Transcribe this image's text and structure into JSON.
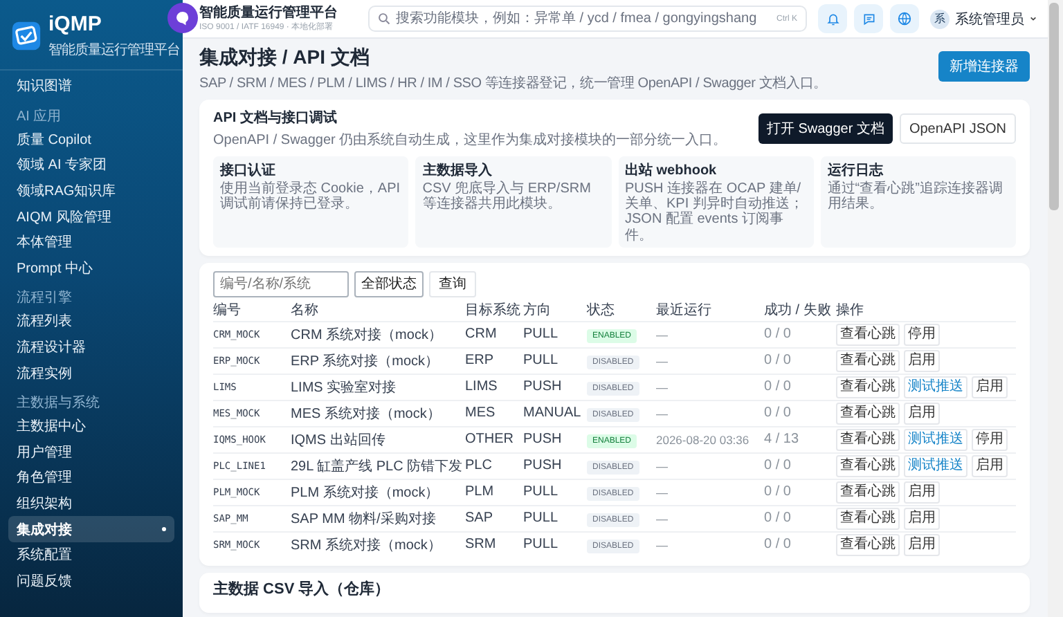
{
  "brand": {
    "name": "iQMP",
    "subtitle": "智能质量运行管理平台"
  },
  "sidebar": {
    "sections": [
      {
        "items": [
          {
            "label": "知识图谱",
            "selected": false
          }
        ]
      },
      {
        "heading": "AI 应用",
        "items": [
          {
            "label": "质量 Copilot",
            "selected": false
          },
          {
            "label": "领域 AI 专家团",
            "selected": false
          },
          {
            "label": "领域RAG知识库",
            "selected": false
          },
          {
            "label": "AIQM 风险管理",
            "selected": false
          },
          {
            "label": "本体管理",
            "selected": false
          },
          {
            "label": "Prompt 中心",
            "selected": false
          }
        ]
      },
      {
        "heading": "流程引擎",
        "items": [
          {
            "label": "流程列表",
            "selected": false
          },
          {
            "label": "流程设计器",
            "selected": false
          },
          {
            "label": "流程实例",
            "selected": false
          }
        ]
      },
      {
        "heading": "主数据与系统",
        "items": [
          {
            "label": "主数据中心",
            "selected": false
          },
          {
            "label": "用户管理",
            "selected": false
          },
          {
            "label": "角色管理",
            "selected": false
          },
          {
            "label": "组织架构",
            "selected": false
          },
          {
            "label": "集成对接",
            "selected": true
          },
          {
            "label": "系统配置",
            "selected": false
          },
          {
            "label": "问题反馈",
            "selected": false
          }
        ]
      }
    ]
  },
  "topbar": {
    "title": "智能质量运行管理平台",
    "subtitle": "ISO 9001 / IATF 16949 · 本地化部署",
    "search": {
      "placeholder": "搜索功能模块，例如：异常单 / ycd / fmea / gongyingshang",
      "shortcut": "Ctrl K"
    },
    "user": {
      "avatar": "系",
      "name": "系统管理员"
    }
  },
  "page": {
    "title": "集成对接 / API 文档",
    "subtitle": "SAP / SRM / MES / PLM / LIMS / HR / IM / SSO 等连接器登记，统一管理 OpenAPI / Swagger 文档入口。",
    "primary_button": "新增连接器"
  },
  "api_card": {
    "title": "API 文档与接口调试",
    "subtitle": "OpenAPI / Swagger 仍由系统自动生成，这里作为集成对接模块的一部分统一入口。",
    "buttons": [
      {
        "label": "打开 Swagger 文档",
        "kind": "dark"
      },
      {
        "label": "OpenAPI JSON",
        "kind": "outline"
      }
    ],
    "tiles": [
      {
        "title": "接口认证",
        "text": "使用当前登录态 Cookie，API 调试前请保持已登录。"
      },
      {
        "title": "主数据导入",
        "text": "CSV 兜底导入与 ERP/SRM 等连接器共用此模块。"
      },
      {
        "title": "出站 webhook",
        "text": "PUSH 连接器在 OCAP 建单/关单、KPI 判异时自动推送；JSON 配置 events 订阅事件。"
      },
      {
        "title": "运行日志",
        "text": "通过“查看心跳”追踪连接器调用结果。"
      }
    ]
  },
  "filters": {
    "search": {
      "placeholder": "编号/名称/系统"
    },
    "status_select": "全部状态",
    "query_button": "查询"
  },
  "table": {
    "columns": [
      "编号",
      "名称",
      "目标系统",
      "方向",
      "状态",
      "最近运行",
      "成功 / 失败",
      "操作"
    ],
    "rows": [
      {
        "code": "CRM_MOCK",
        "name": "CRM 系统对接（mock）",
        "system": "CRM",
        "direction": "PULL",
        "status": "ENABLED",
        "enabled": true,
        "last_run": "—",
        "ratio": "0 / 0",
        "actions": [
          {
            "label": "查看心跳",
            "kind": "plain"
          },
          {
            "label": "停用",
            "kind": "plain"
          }
        ]
      },
      {
        "code": "ERP_MOCK",
        "name": "ERP 系统对接（mock）",
        "system": "ERP",
        "direction": "PULL",
        "status": "DISABLED",
        "enabled": false,
        "last_run": "—",
        "ratio": "0 / 0",
        "actions": [
          {
            "label": "查看心跳",
            "kind": "plain"
          },
          {
            "label": "启用",
            "kind": "plain"
          }
        ]
      },
      {
        "code": "LIMS",
        "name": "LIMS 实验室对接",
        "system": "LIMS",
        "direction": "PUSH",
        "status": "DISABLED",
        "enabled": false,
        "last_run": "—",
        "ratio": "0 / 0",
        "actions": [
          {
            "label": "查看心跳",
            "kind": "plain"
          },
          {
            "label": "测试推送",
            "kind": "link"
          },
          {
            "label": "启用",
            "kind": "plain"
          }
        ]
      },
      {
        "code": "MES_MOCK",
        "name": "MES 系统对接（mock）",
        "system": "MES",
        "direction": "MANUAL",
        "status": "DISABLED",
        "enabled": false,
        "last_run": "—",
        "ratio": "0 / 0",
        "actions": [
          {
            "label": "查看心跳",
            "kind": "plain"
          },
          {
            "label": "启用",
            "kind": "plain"
          }
        ]
      },
      {
        "code": "IQMS_HOOK",
        "name": "IQMS 出站回传",
        "system": "OTHER",
        "direction": "PUSH",
        "status": "ENABLED",
        "enabled": true,
        "last_run": "2026-08-20 03:36",
        "ratio": "4 / 13",
        "actions": [
          {
            "label": "查看心跳",
            "kind": "plain"
          },
          {
            "label": "测试推送",
            "kind": "link"
          },
          {
            "label": "停用",
            "kind": "plain"
          }
        ]
      },
      {
        "code": "PLC_LINE1",
        "name": "29L 缸盖产线 PLC 防错下发",
        "system": "PLC",
        "direction": "PUSH",
        "status": "DISABLED",
        "enabled": false,
        "last_run": "—",
        "ratio": "0 / 0",
        "actions": [
          {
            "label": "查看心跳",
            "kind": "plain"
          },
          {
            "label": "测试推送",
            "kind": "link"
          },
          {
            "label": "启用",
            "kind": "plain"
          }
        ]
      },
      {
        "code": "PLM_MOCK",
        "name": "PLM 系统对接（mock）",
        "system": "PLM",
        "direction": "PULL",
        "status": "DISABLED",
        "enabled": false,
        "last_run": "—",
        "ratio": "0 / 0",
        "actions": [
          {
            "label": "查看心跳",
            "kind": "plain"
          },
          {
            "label": "启用",
            "kind": "plain"
          }
        ]
      },
      {
        "code": "SAP_MM",
        "name": "SAP MM 物料/采购对接",
        "system": "SAP",
        "direction": "PULL",
        "status": "DISABLED",
        "enabled": false,
        "last_run": "—",
        "ratio": "0 / 0",
        "actions": [
          {
            "label": "查看心跳",
            "kind": "plain"
          },
          {
            "label": "启用",
            "kind": "plain"
          }
        ]
      },
      {
        "code": "SRM_MOCK",
        "name": "SRM 系统对接（mock）",
        "system": "SRM",
        "direction": "PULL",
        "status": "DISABLED",
        "enabled": false,
        "last_run": "—",
        "ratio": "0 / 0",
        "actions": [
          {
            "label": "查看心跳",
            "kind": "plain"
          },
          {
            "label": "启用",
            "kind": "plain"
          }
        ]
      }
    ]
  },
  "next_section": {
    "title": "主数据 CSV 导入（仓库）"
  }
}
